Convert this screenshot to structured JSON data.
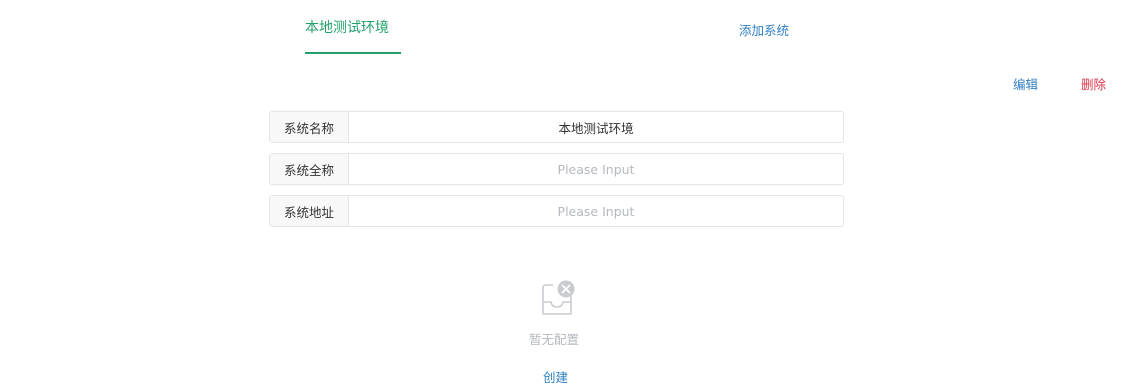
{
  "tabs": {
    "active_label": "本地测试环境",
    "add_label": "添加系统"
  },
  "actions": {
    "edit_label": "编辑",
    "delete_label": "删除"
  },
  "form": {
    "name_label": "系统名称",
    "name_value": "本地测试环境",
    "fullname_label": "系统全称",
    "fullname_placeholder": "Please Input",
    "url_label": "系统地址",
    "url_placeholder": "Please Input"
  },
  "empty": {
    "icon": "empty-inbox-icon",
    "text": "暂无配置",
    "create_label": "创建"
  },
  "colors": {
    "accent": "#23a06a",
    "link": "#2f7fc1",
    "danger": "#d9364a",
    "muted": "#b5b9bf"
  }
}
